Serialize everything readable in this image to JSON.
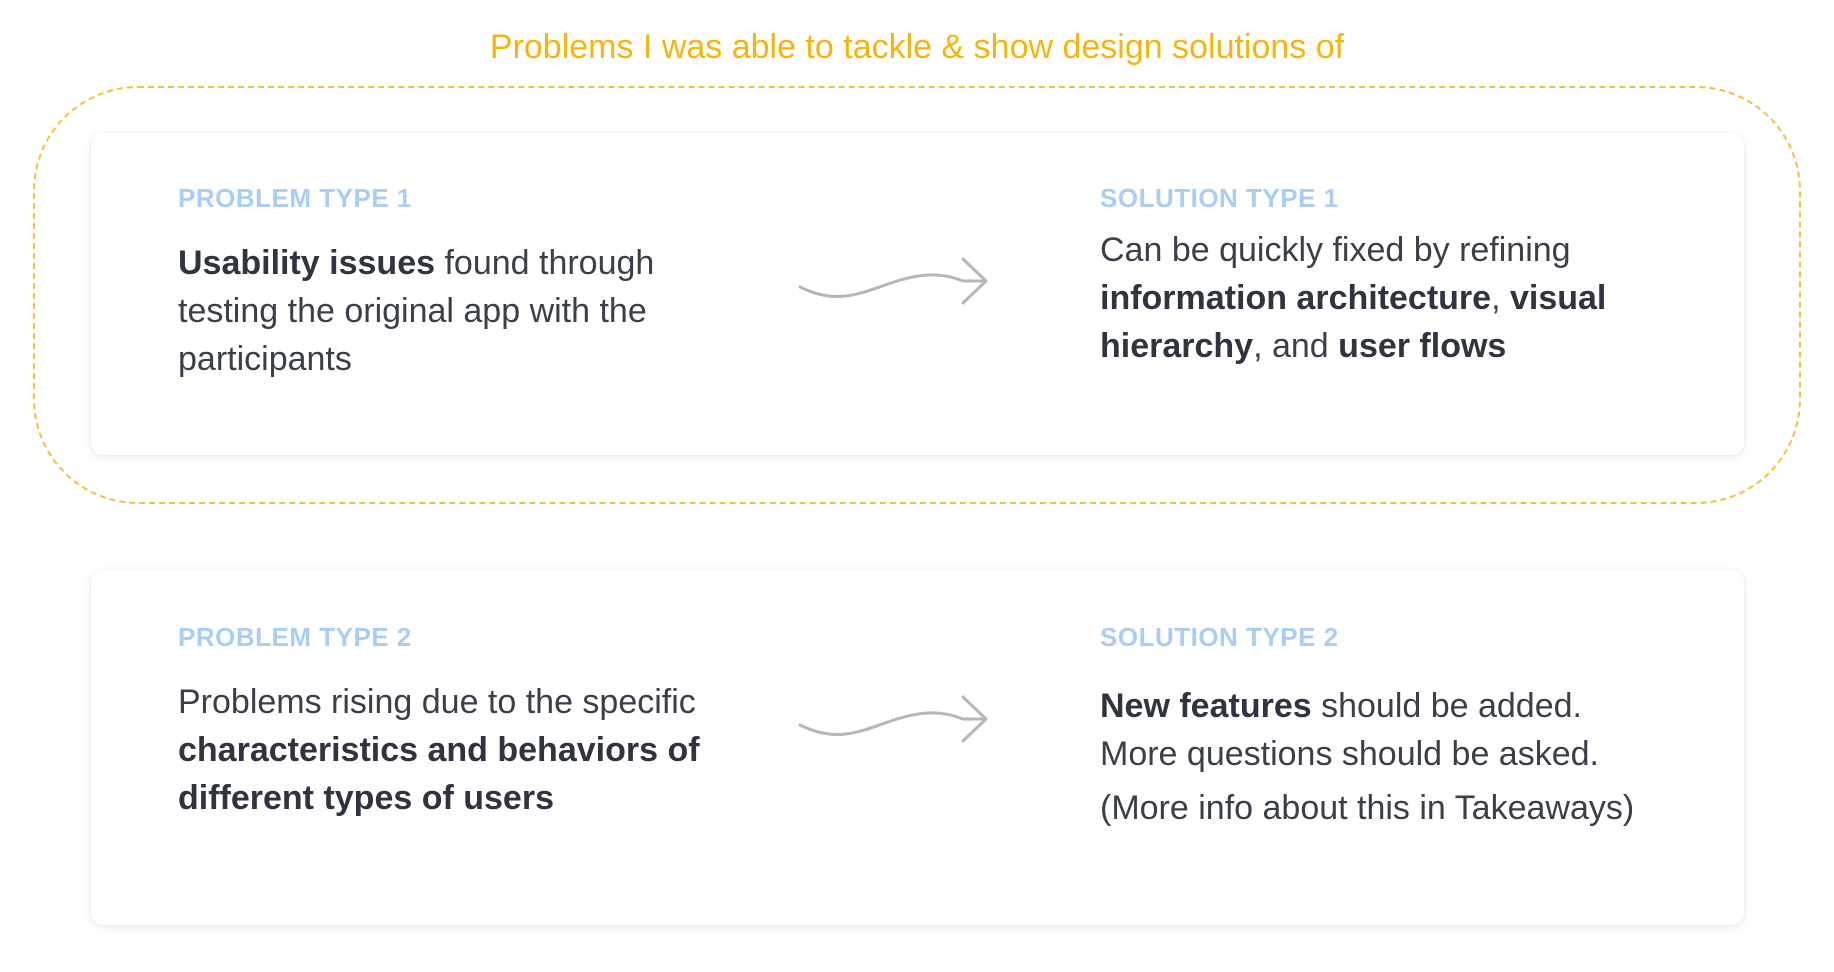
{
  "heading": "Problems I was able to tackle & show design solutions of",
  "colors": {
    "heading": "#F5B50C",
    "dashed_frame": "#F3C13A",
    "type_label": "#A9CDF3",
    "body_text": "#3A3F4A",
    "arrow": "#B4B6BC"
  },
  "rows": [
    {
      "problem": {
        "label": "PROBLEM TYPE 1",
        "segments": [
          {
            "text": "Usability issues",
            "bold": true
          },
          {
            "text": " found through testing the original app with the participants",
            "bold": false
          }
        ]
      },
      "arrow_icon": "squiggle-arrow-right-icon",
      "solution": {
        "label": "SOLUTION TYPE 1",
        "segments": [
          {
            "text": "Can be quickly fixed by refining ",
            "bold": false
          },
          {
            "text": "information architecture",
            "bold": true
          },
          {
            "text": ", ",
            "bold": false
          },
          {
            "text": "visual hierarchy",
            "bold": true
          },
          {
            "text": ", and ",
            "bold": false
          },
          {
            "text": "user flows",
            "bold": true
          }
        ]
      }
    },
    {
      "problem": {
        "label": "PROBLEM TYPE 2",
        "segments": [
          {
            "text": "Problems rising due to the specific ",
            "bold": false
          },
          {
            "text": "characteristics and behaviors of different types of users",
            "bold": true
          }
        ]
      },
      "arrow_icon": "squiggle-arrow-right-icon",
      "solution": {
        "label": "SOLUTION TYPE 2",
        "lines": [
          [
            {
              "text": "New features",
              "bold": true
            },
            {
              "text": " should be added.",
              "bold": false
            }
          ],
          [
            {
              "text": "More questions should be asked.",
              "bold": false
            }
          ],
          [
            {
              "text": "(More info about this in Takeaways)",
              "bold": false
            }
          ]
        ]
      }
    }
  ]
}
